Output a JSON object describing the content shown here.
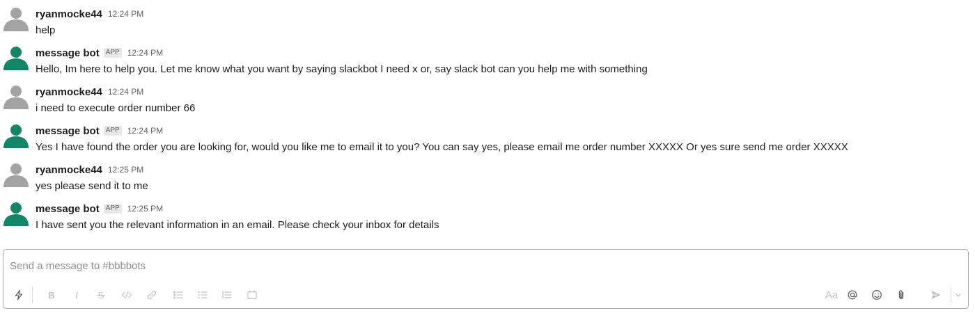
{
  "channel": "#bbbbots",
  "messages": [
    {
      "sender": "ryanmocke44",
      "badge": "",
      "time": "12:24 PM",
      "text": "help",
      "avatar": "user-avatar-gray"
    },
    {
      "sender": "message bot",
      "badge": "APP",
      "time": "12:24 PM",
      "text": "Hello, Im here to help you. Let me know what you want by saying slackbot I need x or, say slack bot can you help me with something",
      "avatar": "bot-avatar-green"
    },
    {
      "sender": "ryanmocke44",
      "badge": "",
      "time": "12:24 PM",
      "text": "i need to execute order number 66",
      "avatar": "user-avatar-gray"
    },
    {
      "sender": "message bot",
      "badge": "APP",
      "time": "12:24 PM",
      "text": "Yes I have found the order you are looking for, would you like me to email it to you? You can say yes, please email me order number XXXXX Or yes sure send me order XXXXX",
      "avatar": "bot-avatar-green"
    },
    {
      "sender": "ryanmocke44",
      "badge": "",
      "time": "12:25 PM",
      "text": "yes please send it to me",
      "avatar": "user-avatar-gray"
    },
    {
      "sender": "message bot",
      "badge": "APP",
      "time": "12:25 PM",
      "text": "I have sent you the relevant information in an email. Please check your inbox for details",
      "avatar": "bot-avatar-green"
    }
  ],
  "composer": {
    "placeholder": "Send a message to #bbbbots",
    "value": "",
    "format_label": "Aa",
    "toolbar_icons": [
      "shortcuts-lightning-icon",
      "bold-icon",
      "italic-icon",
      "strikethrough-icon",
      "code-icon",
      "link-icon",
      "ordered-list-icon",
      "bulleted-list-icon",
      "blockquote-icon",
      "code-block-icon",
      "formatting-aa-icon",
      "mention-at-icon",
      "emoji-icon",
      "attach-paperclip-icon",
      "send-icon",
      "send-options-chevron-icon"
    ]
  },
  "colors": {
    "user_avatar": "#a3a3a3",
    "bot_avatar": "#148567",
    "text": "#1d1c1d",
    "muted": "#616061",
    "border": "#a9a9a9"
  }
}
